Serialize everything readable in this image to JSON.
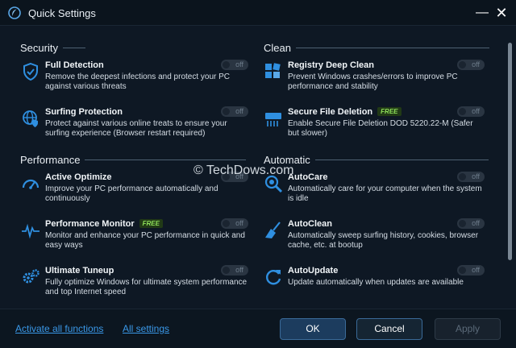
{
  "window": {
    "title": "Quick Settings"
  },
  "sections": {
    "security": "Security",
    "clean": "Clean",
    "performance": "Performance",
    "automatic": "Automatic"
  },
  "items": {
    "full_detection": {
      "name": "Full Detection",
      "desc": "Remove the deepest infections and protect your PC against various threats",
      "state": "off"
    },
    "surfing_protection": {
      "name": "Surfing Protection",
      "desc": "Protect against various online treats to ensure your surfing experience (Browser restart required)",
      "state": "off"
    },
    "active_optimize": {
      "name": "Active Optimize",
      "desc": "Improve your PC performance automatically and continuously",
      "state": "off"
    },
    "performance_monitor": {
      "name": "Performance Monitor",
      "badge": "FREE",
      "desc": "Monitor and enhance your PC performance in quick and easy ways",
      "state": "off"
    },
    "ultimate_tuneup": {
      "name": "Ultimate Tuneup",
      "desc": "Fully optimize Windows for ultimate system performance and top Internet speed",
      "state": "off"
    },
    "registry_deep_clean": {
      "name": "Registry Deep Clean",
      "desc": "Prevent Windows crashes/errors to improve PC performance and stability",
      "state": "off"
    },
    "secure_file_deletion": {
      "name": "Secure File Deletion",
      "badge": "FREE",
      "desc": "Enable Secure File Deletion DOD 5220.22-M (Safer but slower)",
      "state": "off"
    },
    "autocare": {
      "name": "AutoCare",
      "desc": "Automatically care for your computer when the system is idle",
      "state": "off"
    },
    "autoclean": {
      "name": "AutoClean",
      "desc": "Automatically sweep surfing history, cookies, browser cache, etc. at bootup",
      "state": "off"
    },
    "autoupdate": {
      "name": "AutoUpdate",
      "desc": "Update automatically when updates are available",
      "state": "off"
    }
  },
  "watermark": "© TechDows.com",
  "footer": {
    "activate_all": "Activate all functions",
    "all_settings": "All settings",
    "ok": "OK",
    "cancel": "Cancel",
    "apply": "Apply"
  },
  "colors": {
    "background": "#0e1824",
    "accent_blue": "#2f8fe0",
    "free_green": "#8ee05a",
    "link": "#3a98e8"
  }
}
